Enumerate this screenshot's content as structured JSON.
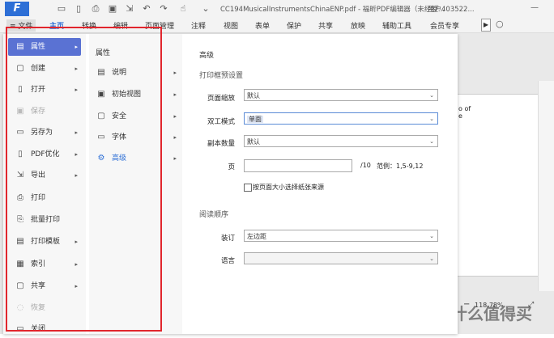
{
  "titlebar": {
    "app_logo": "F",
    "doc_title": "CC194MusicalInstrumentsChinaENP.pdf - 福昕PDF编辑器（未经授...",
    "user": "用户403522..."
  },
  "menubar": {
    "file": "≡ 文件",
    "items": [
      "主页",
      "转换",
      "编辑",
      "页面管理",
      "注释",
      "视图",
      "表单",
      "保护",
      "共享",
      "放映",
      "辅助工具",
      "会员专享"
    ]
  },
  "file_menu": {
    "left": [
      {
        "label": "属性",
        "icon": "properties-icon",
        "arrow": true
      },
      {
        "label": "创建",
        "icon": "create-icon",
        "arrow": true
      },
      {
        "label": "打开",
        "icon": "open-icon",
        "arrow": true
      },
      {
        "label": "保存",
        "icon": "save-icon",
        "arrow": false
      },
      {
        "label": "另存为",
        "icon": "save-as-icon",
        "arrow": true
      },
      {
        "label": "PDF优化",
        "icon": "pdf-optimize-icon",
        "arrow": true
      },
      {
        "label": "导出",
        "icon": "export-icon",
        "arrow": true
      },
      {
        "label": "打印",
        "icon": "print-icon",
        "arrow": false
      },
      {
        "label": "批量打印",
        "icon": "batch-print-icon",
        "arrow": false
      },
      {
        "label": "打印模板",
        "icon": "print-template-icon",
        "arrow": true
      },
      {
        "label": "索引",
        "icon": "index-icon",
        "arrow": true
      },
      {
        "label": "共享",
        "icon": "share-icon",
        "arrow": true
      },
      {
        "label": "恢复",
        "icon": "restore-icon",
        "arrow": false
      },
      {
        "label": "关闭",
        "icon": "close-icon",
        "arrow": false
      }
    ],
    "mid_title": "属性",
    "mid": [
      {
        "label": "说明",
        "icon": "description-icon"
      },
      {
        "label": "初始视图",
        "icon": "initial-view-icon"
      },
      {
        "label": "安全",
        "icon": "security-icon"
      },
      {
        "label": "字体",
        "icon": "font-icon"
      },
      {
        "label": "高级",
        "icon": "advanced-icon"
      }
    ]
  },
  "advanced": {
    "title": "高级",
    "print_section": "打印框预设置",
    "page_scaling_label": "页面缩放",
    "page_scaling_value": "默认",
    "duplex_label": "双工模式",
    "duplex_value": "单面",
    "copies_label": "副本数量",
    "copies_value": "默认",
    "page_label": "页",
    "page_total": "/10",
    "page_range_hint": "范例：1,5-9,12",
    "paper_by_size": "按页面大小选择纸张来源",
    "reading_section": "阅读顺序",
    "binding_label": "装订",
    "binding_value": "左边距",
    "language_label": "语言",
    "language_value": ""
  },
  "background": {
    "doc_snippet_1": "o of",
    "doc_snippet_2": "e",
    "zoom": "118.78%",
    "watermark": "值 什么值得买"
  },
  "colors": {
    "selected": "#5a72d3",
    "annotation": "#e1262d",
    "accent": "#2d6fd6"
  }
}
